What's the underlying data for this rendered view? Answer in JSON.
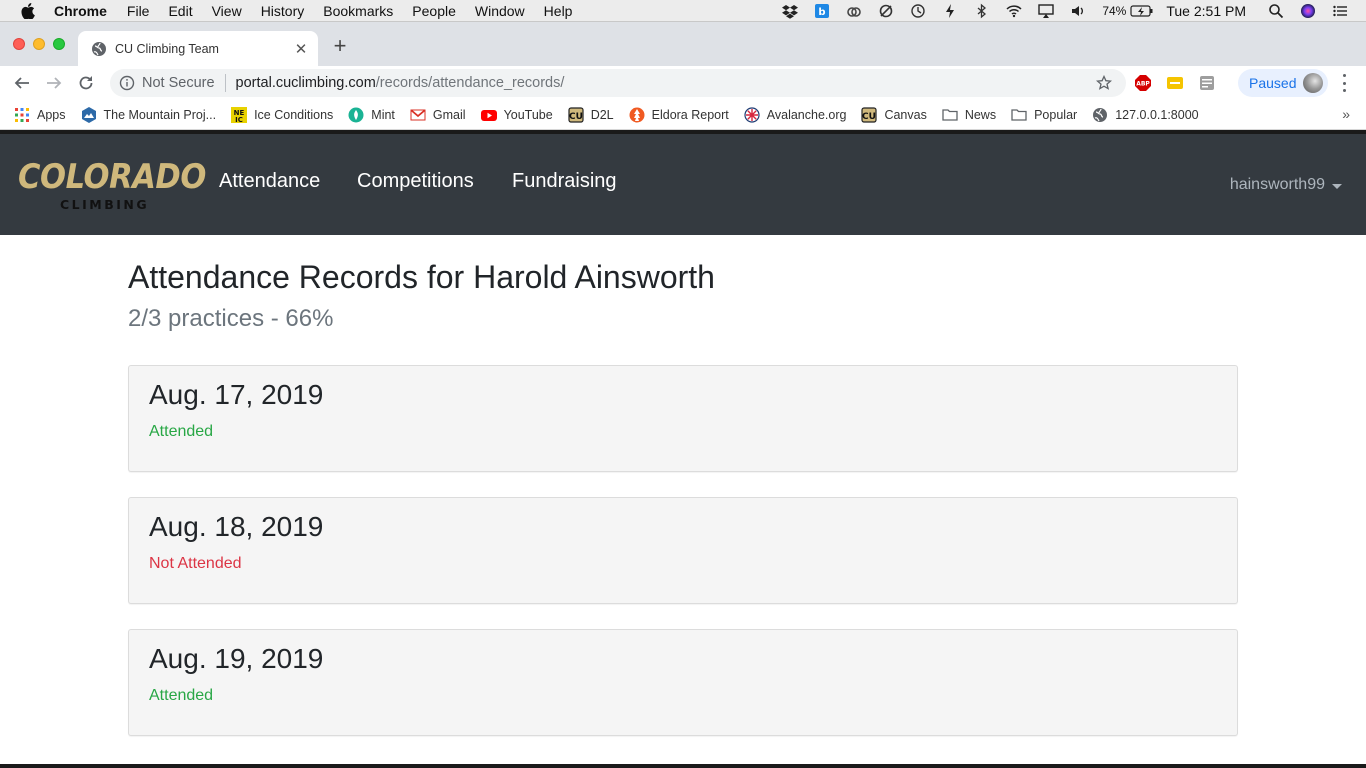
{
  "menubar": {
    "app_name": "Chrome",
    "items": [
      "File",
      "Edit",
      "View",
      "History",
      "Bookmarks",
      "People",
      "Window",
      "Help"
    ],
    "battery": "74%",
    "clock": "Tue 2:51 PM"
  },
  "browser": {
    "tab_title": "CU Climbing Team",
    "security_label": "Not Secure",
    "url_host": "portal.cuclimbing.com",
    "url_path": "/records/attendance_records/",
    "profile_label": "Paused",
    "bookmarks": [
      {
        "label": "Apps",
        "icon": "apps-grid-icon",
        "color": "#e94235"
      },
      {
        "label": "The Mountain Proj...",
        "icon": "mountain-project-icon",
        "color": "#2d6aa8"
      },
      {
        "label": "Ice Conditions",
        "icon": "ice-conditions-icon",
        "color": "#e8d200"
      },
      {
        "label": "Mint",
        "icon": "mint-icon",
        "color": "#1ab394"
      },
      {
        "label": "Gmail",
        "icon": "gmail-icon",
        "color": "#d93025"
      },
      {
        "label": "YouTube",
        "icon": "youtube-icon",
        "color": "#ff0000"
      },
      {
        "label": "D2L",
        "icon": "cu-icon",
        "color": "#cfb87c"
      },
      {
        "label": "Eldora Report",
        "icon": "eldora-icon",
        "color": "#f05a22"
      },
      {
        "label": "Avalanche.org",
        "icon": "avalanche-icon",
        "color": "#d7263d"
      },
      {
        "label": "Canvas",
        "icon": "cu-icon",
        "color": "#cfb87c"
      },
      {
        "label": "News",
        "icon": "folder-icon",
        "color": "#888888"
      },
      {
        "label": "Popular",
        "icon": "folder-icon",
        "color": "#888888"
      },
      {
        "label": "127.0.0.1:8000",
        "icon": "globe-icon",
        "color": "#5f6368"
      }
    ]
  },
  "site": {
    "logo_main": "COLORADO",
    "logo_sub": "CLIMBING",
    "nav": [
      "Attendance",
      "Competitions",
      "Fundraising"
    ],
    "username": "hainsworth99"
  },
  "page": {
    "title": "Attendance Records for Harold Ainsworth",
    "summary": "2/3 practices - 66%",
    "records": [
      {
        "date": "Aug. 17, 2019",
        "status": "Attended"
      },
      {
        "date": "Aug. 18, 2019",
        "status": "Not Attended"
      },
      {
        "date": "Aug. 19, 2019",
        "status": "Attended"
      }
    ]
  },
  "colors": {
    "navbar_bg": "#343a40",
    "brand_gold": "#cfb87c",
    "attended": "#28a745",
    "not_attended": "#dc3545"
  }
}
